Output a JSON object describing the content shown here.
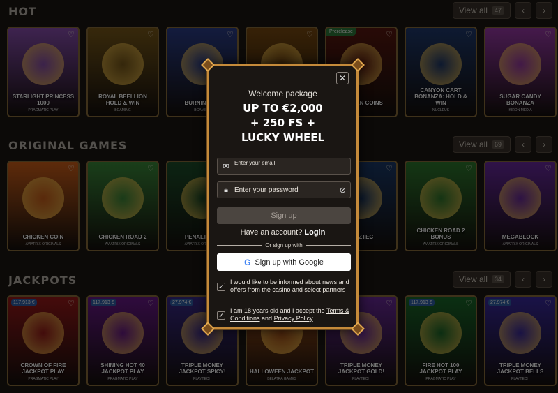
{
  "sections": [
    {
      "title": "HOT",
      "view_all": "View all",
      "count": "47",
      "games": [
        {
          "name": "Starlight Princess 1000",
          "provider": "Pragmatic Play",
          "color": "#8a4fb0"
        },
        {
          "name": "Royal Beellion Hold & Win",
          "provider": "Bgaming",
          "color": "#7a5a1a"
        },
        {
          "name": "Burning Ch",
          "provider": "Bgaming",
          "color": "#2b3e8a"
        },
        {
          "name": "",
          "provider": "",
          "color": "#7a4a10"
        },
        {
          "name": "Golden Coins",
          "provider": "",
          "color": "#5a1810",
          "tag": "Prerelease"
        },
        {
          "name": "Canyon Cart Bonanza: Hold & Win",
          "provider": "Nucleus",
          "color": "#1f3a6e"
        },
        {
          "name": "Sugar Candy Bonanza",
          "provider": "Kiron Media",
          "color": "#9a3aa8"
        }
      ]
    },
    {
      "title": "ORIGINAL GAMES",
      "view_all": "View all",
      "count": "69",
      "games": [
        {
          "name": "Chicken Coin",
          "provider": "Aviatrix Originals",
          "color": "#d0601a"
        },
        {
          "name": "Chicken Road 2",
          "provider": "Aviatrix Originals",
          "color": "#3b8a3a"
        },
        {
          "name": "Penalty Un",
          "provider": "Aviatrix Originals",
          "color": "#1d4f2a"
        },
        {
          "name": "",
          "provider": "",
          "color": "#3a3a3a"
        },
        {
          "name": "d Aztec",
          "provider": "",
          "color": "#1b3a6a"
        },
        {
          "name": "Chicken Road 2 Bonus",
          "provider": "Aviatrix Originals",
          "color": "#2f7a2e"
        },
        {
          "name": "Megablock",
          "provider": "Aviatrix Originals",
          "color": "#6a2aa0"
        }
      ]
    },
    {
      "title": "JACKPOTS",
      "view_all": "View all",
      "count": "34",
      "games": [
        {
          "name": "Crown of Fire Jackpot Play",
          "provider": "Pragmatic Play",
          "color": "#9a1a1a",
          "jackpot": "117,913 €"
        },
        {
          "name": "Shining Hot 40 Jackpot Play",
          "provider": "Pragmatic Play",
          "color": "#6a1a8a",
          "jackpot": "117,913 €"
        },
        {
          "name": "Triple Money Jackpot Spicy!",
          "provider": "Playtech",
          "color": "#3a2a8a",
          "jackpot": "27,974 €"
        },
        {
          "name": "Halloween Jackpot",
          "provider": "Belatra Games",
          "color": "#b0561a"
        },
        {
          "name": "Triple Money Jackpot Gold!",
          "provider": "Playtech",
          "color": "#6a2a9a"
        },
        {
          "name": "Fire Hot 100 Jackpot Play",
          "provider": "Pragmatic Play",
          "color": "#1a6a2a",
          "jackpot": "117,913 €"
        },
        {
          "name": "Triple Money Jackpot Bells",
          "provider": "Playtech",
          "color": "#3a2aa0",
          "jackpot": "27,974 €"
        }
      ]
    }
  ],
  "modal": {
    "close_icon": "close-icon",
    "welcome": "Welcome package",
    "headline_1": "UP TO €2,000",
    "headline_2": "+ 250 FS +",
    "headline_3": "LUCKY WHEEL",
    "email_placeholder": "Enter your email",
    "password_placeholder": "Enter your password",
    "signup_label": "Sign up",
    "have_account": "Have an account?",
    "login_label": "Login",
    "or_signup_with": "Or sign up with",
    "google_label": "Sign up with Google",
    "newsletter_text": "I would like to be informed about news and offers from the casino and select partners",
    "age_text_1": "I am 18 years old and I accept the",
    "terms_link": "Terms & Conditions",
    "age_text_and": "and",
    "privacy_link": "Privacy Policy",
    "accent_color": "#c58a3a"
  }
}
